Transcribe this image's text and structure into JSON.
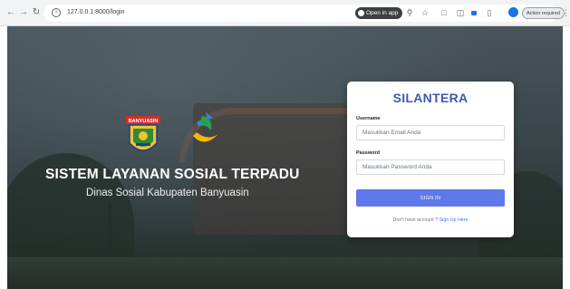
{
  "browser": {
    "url": "127.0.0.1:8000/login",
    "open_in_app": "Open in app",
    "action_required": "Action required",
    "icons": [
      "back-icon",
      "forward-icon",
      "reload-icon",
      "info-icon",
      "zoom-icon",
      "star-icon",
      "extension-icon",
      "sidebar-icon",
      "extension-badge-icon",
      "puzzle-icon",
      "profile-icon",
      "kebab-menu-icon"
    ]
  },
  "hero": {
    "title": "SISTEM LAYANAN SOSIAL TERPADU",
    "subtitle": "Dinas Sosial Kabupaten Banyuasin",
    "logo_text": "BANYUASIN"
  },
  "login": {
    "title": "SILANTERA",
    "username_label": "Username",
    "username_placeholder": "Masukkan Email Anda",
    "password_label": "Password",
    "password_placeholder": "Masukkan Password Anda",
    "signin_label": "SIGN IN",
    "signup_prompt": "Don't have account ?",
    "signup_link": "Sign Up Here"
  },
  "colors": {
    "accent": "#3b5ba9",
    "button": "#5f79ea",
    "link": "#4a6cf7"
  }
}
